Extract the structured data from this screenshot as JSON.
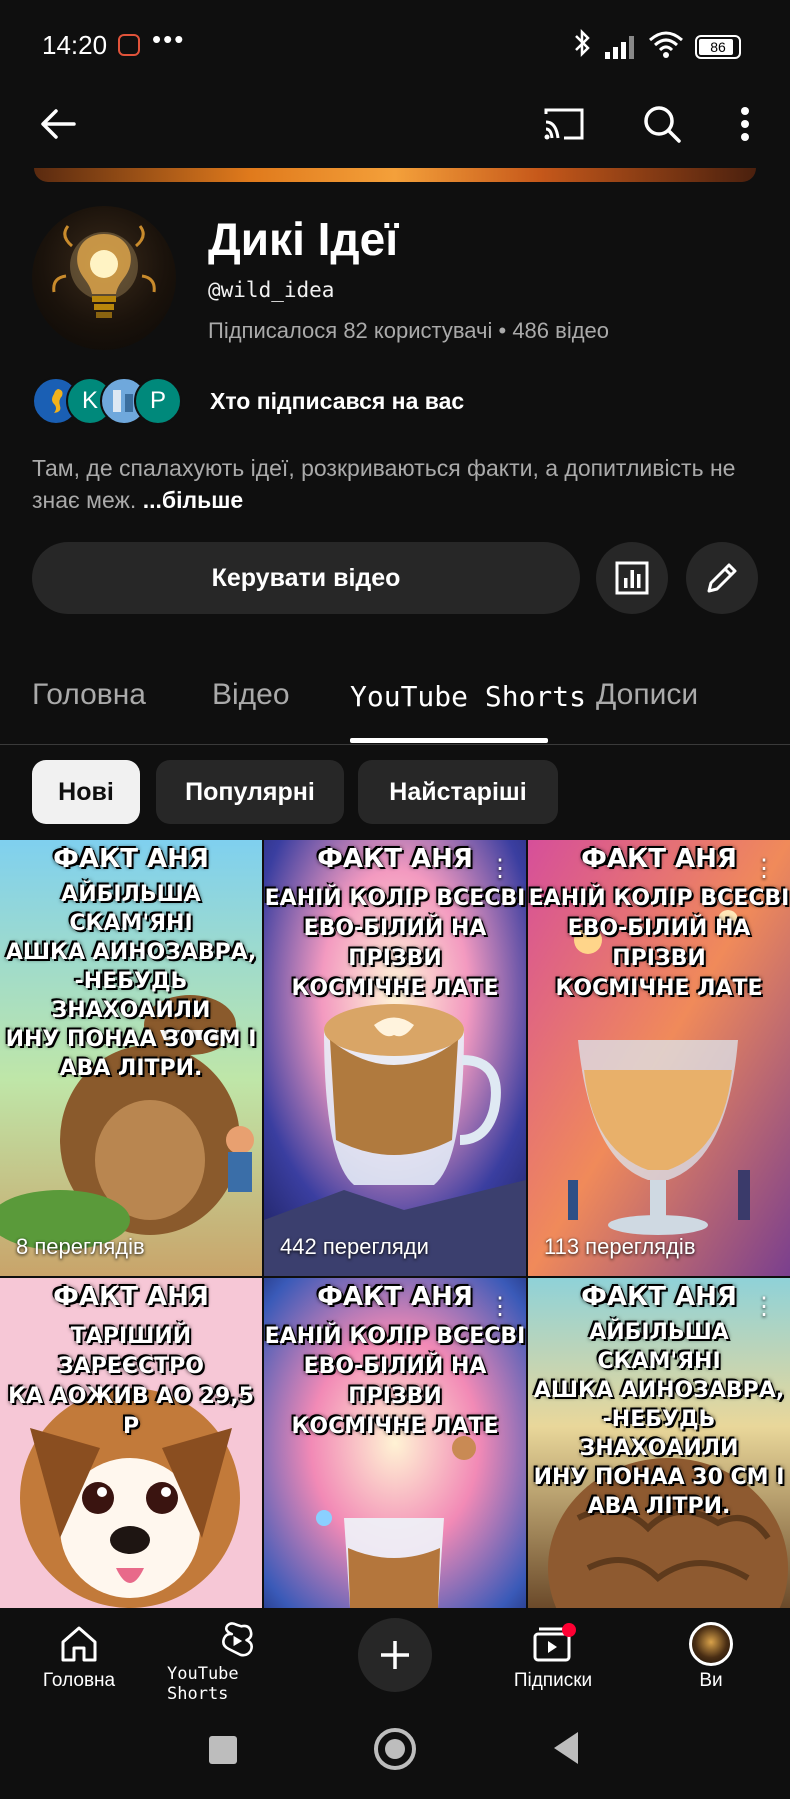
{
  "status_bar": {
    "time": "14:20",
    "more_glyph": "•••",
    "battery": "86",
    "icons": [
      "notification-app-icon",
      "bluetooth-icon",
      "signal-icon",
      "wifi-icon",
      "battery-icon"
    ]
  },
  "app_bar": {
    "icons": [
      "back-arrow-icon",
      "cast-icon",
      "search-icon",
      "more-vert-icon"
    ]
  },
  "channel": {
    "name": "Дикі Ідеї",
    "handle": "@wild_idea",
    "meta": "Підписалося 82 користувачі • 486 відео",
    "subscribers_label": "Хто підписався на вас",
    "subscriber_avatars": [
      {
        "letter": "",
        "color": "#1a5fb4"
      },
      {
        "letter": "K",
        "color": "#00897b"
      },
      {
        "letter": "",
        "color": "#6fa8dc"
      },
      {
        "letter": "P",
        "color": "#00897b"
      }
    ],
    "description": "Там, де спалахують ідеї, розкриваються факти, а допитливість не знає меж.",
    "more_label": "...більше",
    "manage_button": "Керувати відео",
    "stats_icon": "analytics-icon",
    "edit_icon": "pencil-icon"
  },
  "tabs": [
    {
      "label": "Головна",
      "active": false
    },
    {
      "label": "Відео",
      "active": false
    },
    {
      "label": "YouTube Shorts",
      "active": true
    },
    {
      "label": "Дописи",
      "active": false
    }
  ],
  "chips": [
    {
      "label": "Нові",
      "active": true
    },
    {
      "label": "Популярні",
      "active": false
    },
    {
      "label": "Найстаріші",
      "active": false
    }
  ],
  "shorts": [
    {
      "header": "ФАКТ АНЯ",
      "caption": [
        "АЙБІЛЬША СКАМ'ЯНІ",
        "АШКА АИНОЗАВРА,",
        "-НЕБУДЬ ЗНАХОАИЛИ",
        "ИНУ ПОНАА 30 СМ І",
        "АВА ЛІТРИ."
      ],
      "views": "8 переглядів",
      "theme": "dino"
    },
    {
      "header": "ФАКТ АНЯ",
      "caption": [
        "ЕАНІЙ КОЛІР ВСЕСВІ",
        "ЕВО-БІЛИЙ НА ПРІЗВИ",
        "КОСМІЧНЕ ЛАТЕ"
      ],
      "views": "442 перегляди",
      "theme": "latte"
    },
    {
      "header": "ФАКТ АНЯ",
      "caption": [
        "ЕАНІЙ КОЛІР ВСЕСВІ",
        "ЕВО-БІЛИЙ НА ПРІЗВИ",
        "КОСМІЧНЕ ЛАТЕ"
      ],
      "views": "113 переглядів",
      "theme": "glass"
    },
    {
      "header": "ФАКТ АНЯ",
      "caption": [
        "ТАРІШИЙ ЗАРЕЄСТРО",
        "КА АОЖИВ АО 29,5 Р"
      ],
      "views": "",
      "theme": "dog"
    },
    {
      "header": "ФАКТ АНЯ",
      "caption": [
        "ЕАНІЙ КОЛІР ВСЕСВІ",
        "ЕВО-БІЛИЙ НА ПРІЗВИ",
        "КОСМІЧНЕ ЛАТЕ"
      ],
      "views": "",
      "theme": "latte2"
    },
    {
      "header": "ФАКТ АНЯ",
      "caption": [
        "АЙБІЛЬША СКАМ'ЯНІ",
        "АШКА АИНОЗАВРА,",
        "-НЕБУДЬ ЗНАХОАИЛИ",
        "ИНУ ПОНАА 30 СМ І",
        "АВА ЛІТРИ."
      ],
      "views": "",
      "theme": "rock"
    }
  ],
  "bottom_nav": [
    {
      "label": "Головна",
      "icon": "home-icon"
    },
    {
      "label": "YouTube Shorts",
      "icon": "shorts-icon"
    },
    {
      "label": "",
      "icon": "create-plus-icon"
    },
    {
      "label": "Підписки",
      "icon": "subscriptions-icon"
    },
    {
      "label": "Ви",
      "icon": "you-avatar-icon"
    }
  ],
  "system_nav": {
    "icons": [
      "recents-square-icon",
      "home-circle-icon",
      "back-triangle-icon"
    ]
  },
  "colors": {
    "background": "#0f0f0f",
    "surface": "#272727",
    "secondary_text": "#aaaaaa",
    "notification_red": "#ff0033"
  }
}
